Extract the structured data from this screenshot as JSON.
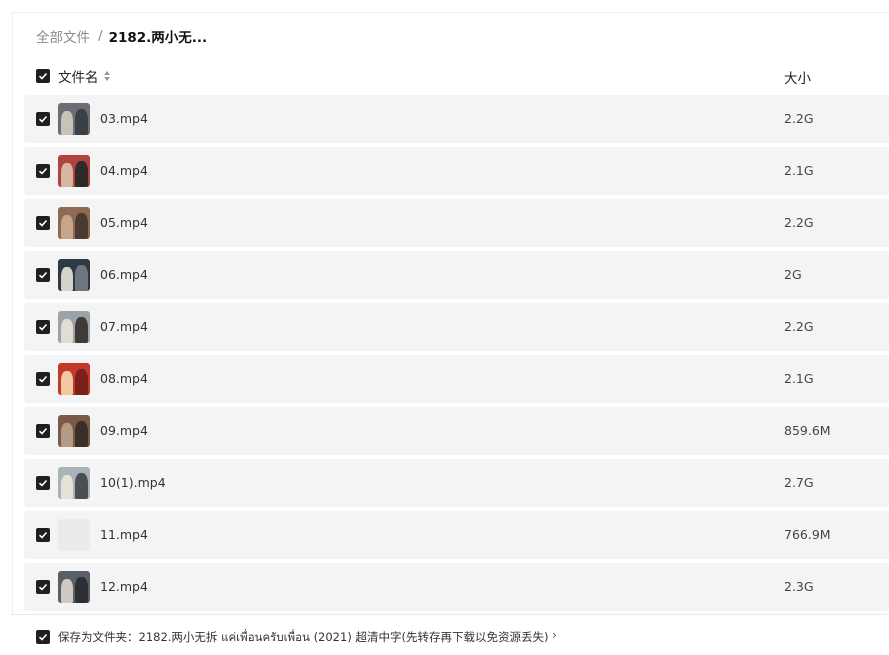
{
  "breadcrumb": {
    "root": "全部文件",
    "separator": "/",
    "current": "2182.两小无..."
  },
  "table": {
    "header": {
      "name_label": "文件名",
      "size_label": "大小"
    },
    "rows": [
      {
        "name": "03.mp4",
        "size": "2.2G",
        "thumb_icon": "video-thumbnail"
      },
      {
        "name": "04.mp4",
        "size": "2.1G",
        "thumb_icon": "video-thumbnail"
      },
      {
        "name": "05.mp4",
        "size": "2.2G",
        "thumb_icon": "video-thumbnail"
      },
      {
        "name": "06.mp4",
        "size": "2G",
        "thumb_icon": "video-thumbnail"
      },
      {
        "name": "07.mp4",
        "size": "2.2G",
        "thumb_icon": "video-thumbnail"
      },
      {
        "name": "08.mp4",
        "size": "2.1G",
        "thumb_icon": "video-thumbnail"
      },
      {
        "name": "09.mp4",
        "size": "859.6M",
        "thumb_icon": "video-thumbnail"
      },
      {
        "name": "10(1).mp4",
        "size": "2.7G",
        "thumb_icon": "video-thumbnail"
      },
      {
        "name": "11.mp4",
        "size": "766.9M",
        "thumb_icon": "blank-thumbnail"
      },
      {
        "name": "12.mp4",
        "size": "2.3G",
        "thumb_icon": "video-thumbnail"
      }
    ]
  },
  "footer": {
    "save_label": "保存为文件夹：2182.两小无拆 แค่เพื่อนครับเพื่อน (2021) 超清中字(先转存再下载以免资源丢失)",
    "chevron": "›"
  },
  "colors": {
    "checkbox": "#1f1f1f",
    "row_background": "#f4f4f4",
    "text_muted": "#8a8a8a"
  }
}
